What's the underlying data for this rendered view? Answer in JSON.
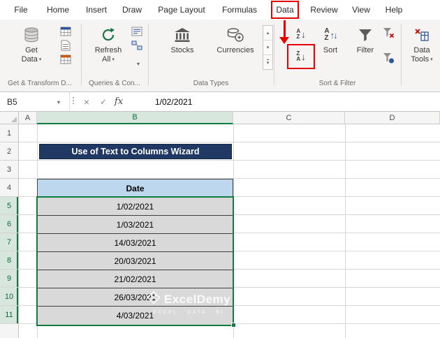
{
  "menubar": {
    "tabs": [
      "File",
      "Home",
      "Insert",
      "Draw",
      "Page Layout",
      "Formulas",
      "Data",
      "Review",
      "View",
      "Help"
    ]
  },
  "ribbon": {
    "buttons": {
      "get_data_1": "Get",
      "get_data_2": "Data",
      "refresh_1": "Refresh",
      "refresh_2": "All",
      "stocks": "Stocks",
      "currencies": "Currencies",
      "sort": "Sort",
      "filter": "Filter",
      "data_tools_1": "Data",
      "data_tools_2": "Tools"
    },
    "sort_az": {
      "top": "A",
      "bottom": "Z"
    },
    "sort_za": {
      "top": "Z",
      "bottom": "A"
    },
    "group_labels": [
      "Get & Transform D...",
      "Queries & Con...",
      "Data Types",
      "Sort & Filter"
    ],
    "glyphs": {
      "chevron_down": "▾",
      "chevron_up": "▴",
      "arrow_down": "↓",
      "arrow_up": "↑"
    }
  },
  "formula_bar": {
    "name_box": "B5",
    "cancel": "×",
    "enter": "✓",
    "fx": "fx",
    "value": "1/02/2021"
  },
  "sheet": {
    "columns": [
      "A",
      "B",
      "C",
      "D"
    ],
    "rows": [
      "1",
      "2",
      "3",
      "4",
      "5",
      "6",
      "7",
      "8",
      "9",
      "10",
      "11"
    ],
    "title_banner": "Use of Text to Columns Wizard",
    "table": {
      "header": "Date",
      "dates": [
        "1/02/2021",
        "1/03/2021",
        "14/03/2021",
        "20/03/2021",
        "21/02/2021",
        "26/03/2021",
        "4/03/2021"
      ]
    },
    "watermark": {
      "name": "ExcelDemy",
      "tagline": "EXCEL · DATA · BI"
    }
  },
  "annotations": {
    "highlight_color": "#e60000"
  }
}
